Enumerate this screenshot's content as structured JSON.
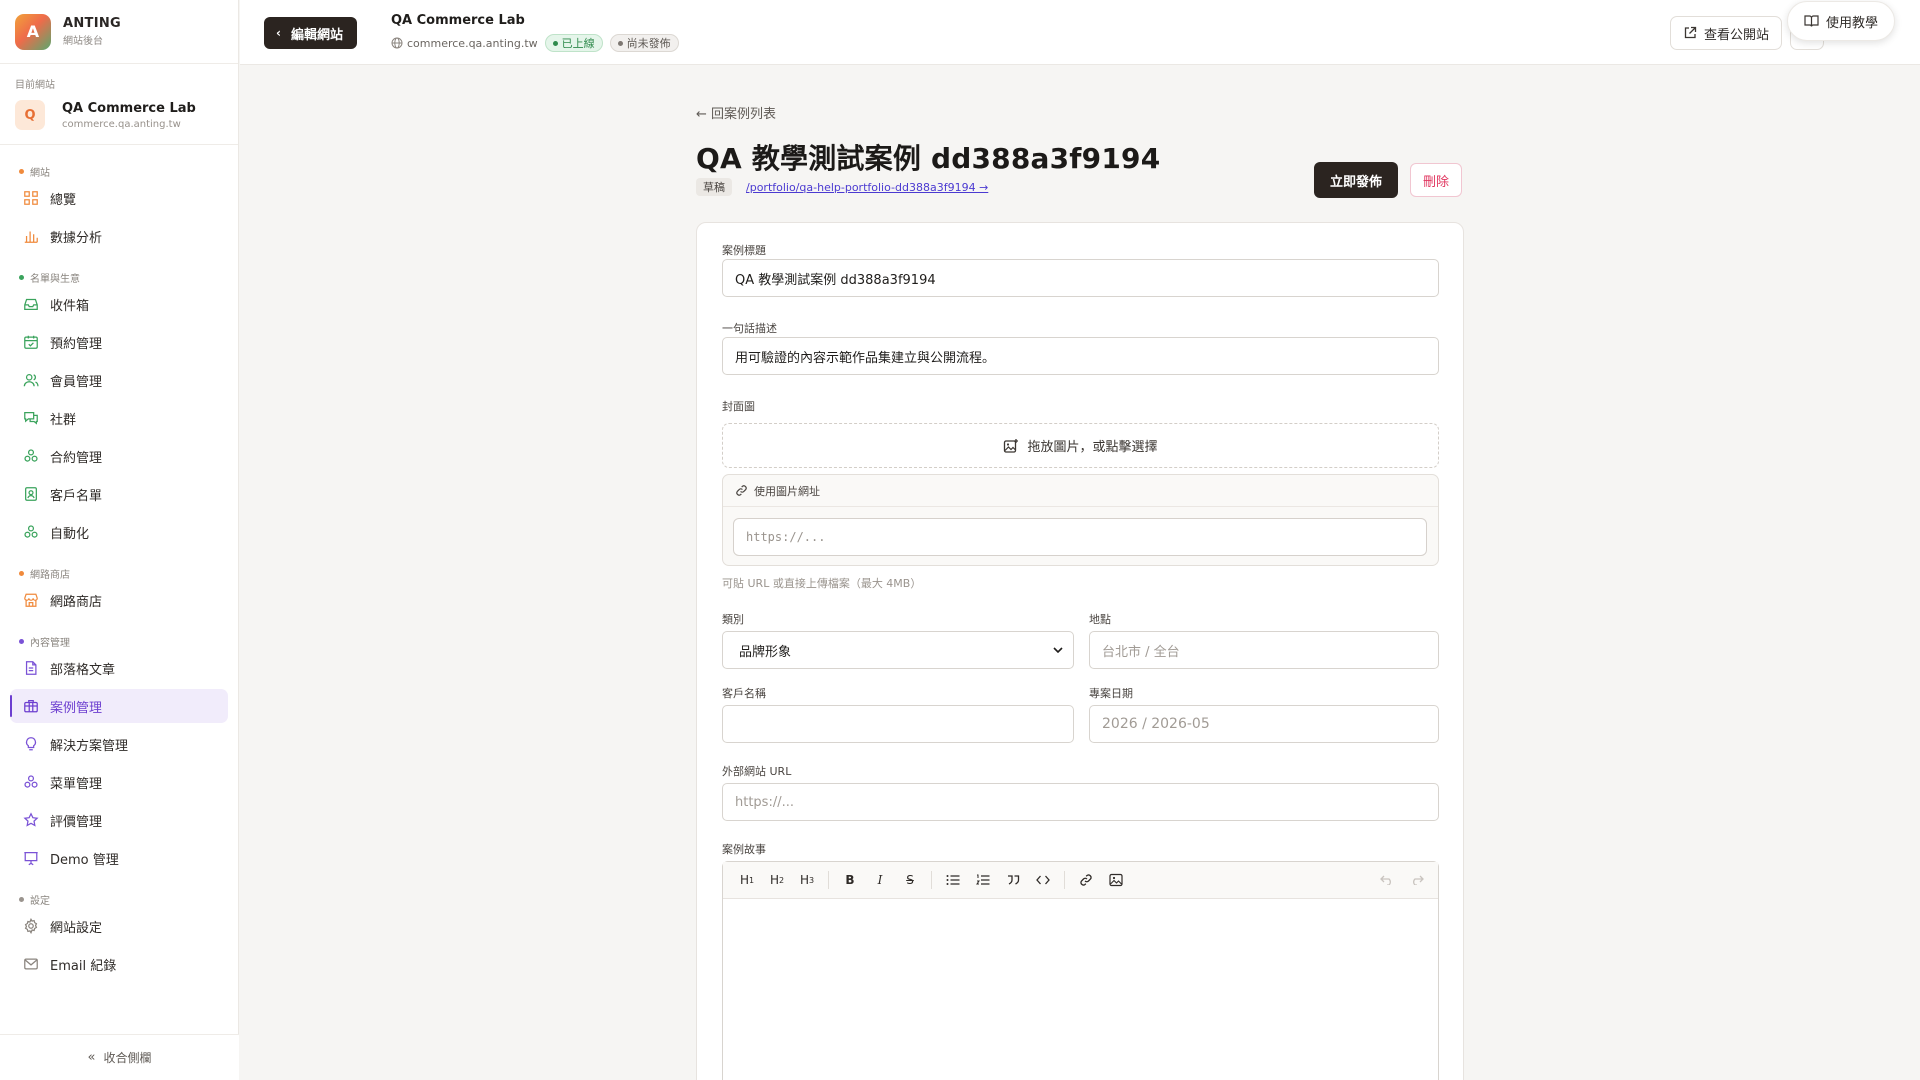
{
  "brand": {
    "logo_letter": "A",
    "name": "ANTING",
    "subtitle": "網站後台"
  },
  "current_site": {
    "label": "目前網站",
    "avatar": "Q",
    "name": "QA Commerce Lab",
    "domain": "commerce.qa.anting.tw"
  },
  "nav": {
    "sections": [
      {
        "title": "網站",
        "color": "#f08a3c",
        "items": [
          {
            "label": "總覽",
            "icon": "grid-icon",
            "color": "#f08a3c"
          },
          {
            "label": "數據分析",
            "icon": "bar-chart-icon",
            "color": "#f08a3c"
          }
        ]
      },
      {
        "title": "名單與生意",
        "color": "#3aa35c",
        "items": [
          {
            "label": "收件箱",
            "icon": "inbox-icon",
            "color": "#3aa35c"
          },
          {
            "label": "預約管理",
            "icon": "calendar-icon",
            "color": "#3aa35c"
          },
          {
            "label": "會員管理",
            "icon": "users-icon",
            "color": "#3aa35c"
          },
          {
            "label": "社群",
            "icon": "chat-icon",
            "color": "#3aa35c"
          },
          {
            "label": "合約管理",
            "icon": "cluster-icon",
            "color": "#3aa35c"
          },
          {
            "label": "客戶名單",
            "icon": "contact-icon",
            "color": "#3aa35c"
          },
          {
            "label": "自動化",
            "icon": "cluster-icon",
            "color": "#3aa35c"
          }
        ]
      },
      {
        "title": "網路商店",
        "color": "#f08a3c",
        "items": [
          {
            "label": "網路商店",
            "icon": "store-icon",
            "color": "#f08a3c"
          }
        ]
      },
      {
        "title": "內容管理",
        "color": "#7a52d6",
        "items": [
          {
            "label": "部落格文章",
            "icon": "document-icon",
            "color": "#7a52d6"
          },
          {
            "label": "案例管理",
            "icon": "briefcase-icon",
            "color": "#7a52d6",
            "active": true
          },
          {
            "label": "解決方案管理",
            "icon": "lightbulb-icon",
            "color": "#7a52d6"
          },
          {
            "label": "菜單管理",
            "icon": "cluster-icon",
            "color": "#7a52d6"
          },
          {
            "label": "評價管理",
            "icon": "star-icon",
            "color": "#7a52d6"
          },
          {
            "label": "Demo 管理",
            "icon": "presentation-icon",
            "color": "#7a52d6"
          }
        ]
      },
      {
        "title": "設定",
        "color": "#9a948e",
        "items": [
          {
            "label": "網站設定",
            "icon": "gear-icon",
            "color": "#8a847e"
          },
          {
            "label": "Email 紀錄",
            "icon": "mail-icon",
            "color": "#8a847e"
          }
        ]
      }
    ],
    "collapse_label": "收合側欄"
  },
  "topbar": {
    "edit_button": "編輯網站",
    "site_title": "QA Commerce Lab",
    "site_domain": "commerce.qa.anting.tw",
    "badge_live": "已上線",
    "badge_unpublished": "尚未發佈",
    "view_public": "查看公開站",
    "help": "使用教學"
  },
  "page": {
    "back_link": "← 回案例列表",
    "title": "QA 教學測試案例 dd388a3f9194",
    "status_badge": "草稿",
    "slug_link": "/portfolio/qa-help-portfolio-dd388a3f9194 →",
    "publish_button": "立即發佈",
    "delete_button": "刪除"
  },
  "form": {
    "title_label": "案例標題",
    "title_value": "QA 教學測試案例 dd388a3f9194",
    "desc_label": "一句話描述",
    "desc_value": "用可驗證的內容示範作品集建立與公開流程。",
    "cover_label": "封面圖",
    "dropzone_text": "拖放圖片，或點擊選擇",
    "image_url_label": "使用圖片網址",
    "image_url_placeholder": "https://...",
    "hint": "可貼 URL 或直接上傳檔案（最大 4MB）",
    "category_label": "類別",
    "category_value": "品牌形象",
    "location_label": "地點",
    "location_placeholder": "台北市 / 全台",
    "client_label": "客戶名稱",
    "client_value": "",
    "date_label": "專案日期",
    "date_placeholder": "2026 / 2026-05",
    "external_url_label": "外部網站 URL",
    "external_url_placeholder": "https://...",
    "story_label": "案例故事",
    "toolbar": [
      "H1",
      "H2",
      "H3",
      "B",
      "I",
      "S",
      "bullet-list",
      "ordered-list",
      "quote",
      "code",
      "link",
      "image",
      "undo",
      "redo"
    ]
  }
}
